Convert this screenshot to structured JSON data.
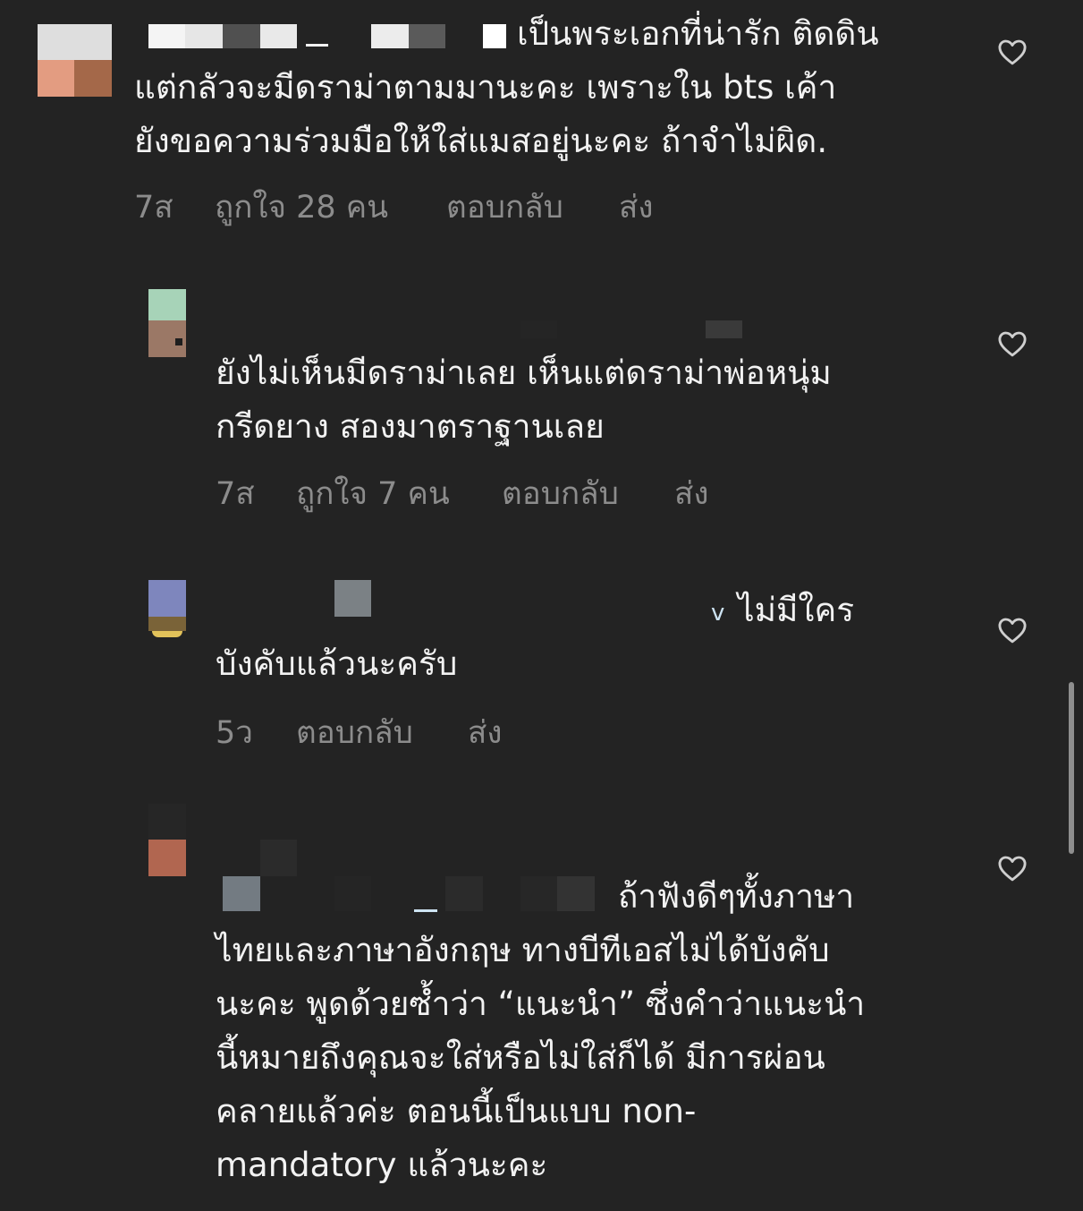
{
  "comments": [
    {
      "lines": [
        "เป็นพระเอกที่น่ารัก ติดดิน",
        "แต่กลัวจะมีดราม่าตามมานะคะ เพราะใน bts เค้า",
        "ยังขอความร่วมมือให้ใส่แมสอยู่นะคะ ถ้าจำไม่ผิด."
      ],
      "time": "7ส",
      "likes": "ถูกใจ 28 คน",
      "reply": "ตอบกลับ",
      "send": "ส่ง"
    },
    {
      "lines": [
        "ยังไม่เห็นมีดราม่าเลย เห็นแต่ดราม่าพ่อหนุ่ม",
        "กรีดยาง สองมาตราฐานเลย"
      ],
      "time": "7ส",
      "likes": "ถูกใจ 7 คน",
      "reply": "ตอบกลับ",
      "send": "ส่ง"
    },
    {
      "lines": [
        "ไม่มีใคร",
        "บังคับแล้วนะครับ"
      ],
      "time": "5ว",
      "reply": "ตอบกลับ",
      "send": "ส่ง"
    },
    {
      "lines": [
        "ถ้าฟังดีๆทั้งภาษา",
        "ไทยและภาษาอังกฤษ ทางบีทีเอสไม่ได้บังคับ",
        "นะคะ พูดด้วยซ้ำว่า “แนะนำ” ซึ่งคำว่าแนะนำ",
        "นี้หมายถึงคุณจะใส่หรือไม่ใส่ก็ได้ มีการผ่อน",
        "คลายแล้วค่ะ ตอนนี้เป็นแบบ non-",
        "mandatory แล้วนะคะ"
      ]
    }
  ],
  "colors": {
    "background": "#232323",
    "text": "#f2f2f2",
    "meta": "#8c8c8c",
    "icon": "#cfcfcf"
  },
  "icons": [
    "heart-outline-icon"
  ]
}
